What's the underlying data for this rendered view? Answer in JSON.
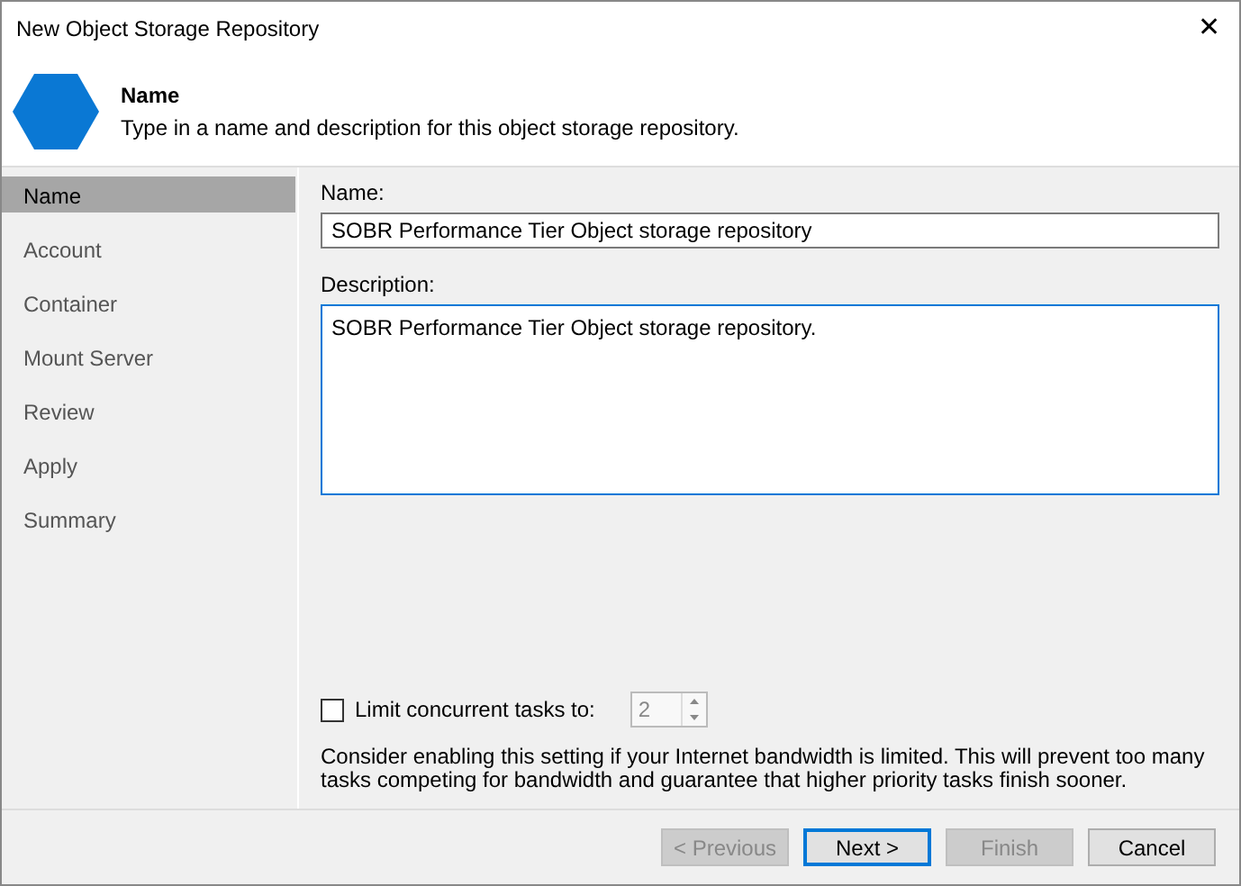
{
  "window": {
    "title": "New Object Storage Repository",
    "close": "✕"
  },
  "header": {
    "title": "Name",
    "subtitle": "Type in a name and description for this object storage repository."
  },
  "steps": [
    {
      "label": "Name",
      "selected": true
    },
    {
      "label": "Account",
      "selected": false
    },
    {
      "label": "Container",
      "selected": false
    },
    {
      "label": "Mount Server",
      "selected": false
    },
    {
      "label": "Review",
      "selected": false
    },
    {
      "label": "Apply",
      "selected": false
    },
    {
      "label": "Summary",
      "selected": false
    }
  ],
  "name_field": {
    "label": "Name:",
    "value": "SOBR Performance Tier Object storage repository"
  },
  "description_field": {
    "label": "Description:",
    "value": "SOBR Performance Tier Object storage repository.",
    "focused": true
  },
  "limit_tasks": {
    "label": "Limit concurrent tasks to:",
    "checked": false,
    "value": "2",
    "disabled": true
  },
  "note": "Consider enabling this setting if your Internet bandwidth is limited. This will prevent too many tasks competing for bandwidth and guarantee that higher priority tasks finish sooner.",
  "buttons": [
    {
      "label": "< Previous",
      "disabled": true,
      "default": false
    },
    {
      "label": "Next >",
      "disabled": false,
      "default": true
    },
    {
      "label": "Finish",
      "disabled": true,
      "default": false
    },
    {
      "label": "Cancel",
      "disabled": false,
      "default": false
    }
  ]
}
